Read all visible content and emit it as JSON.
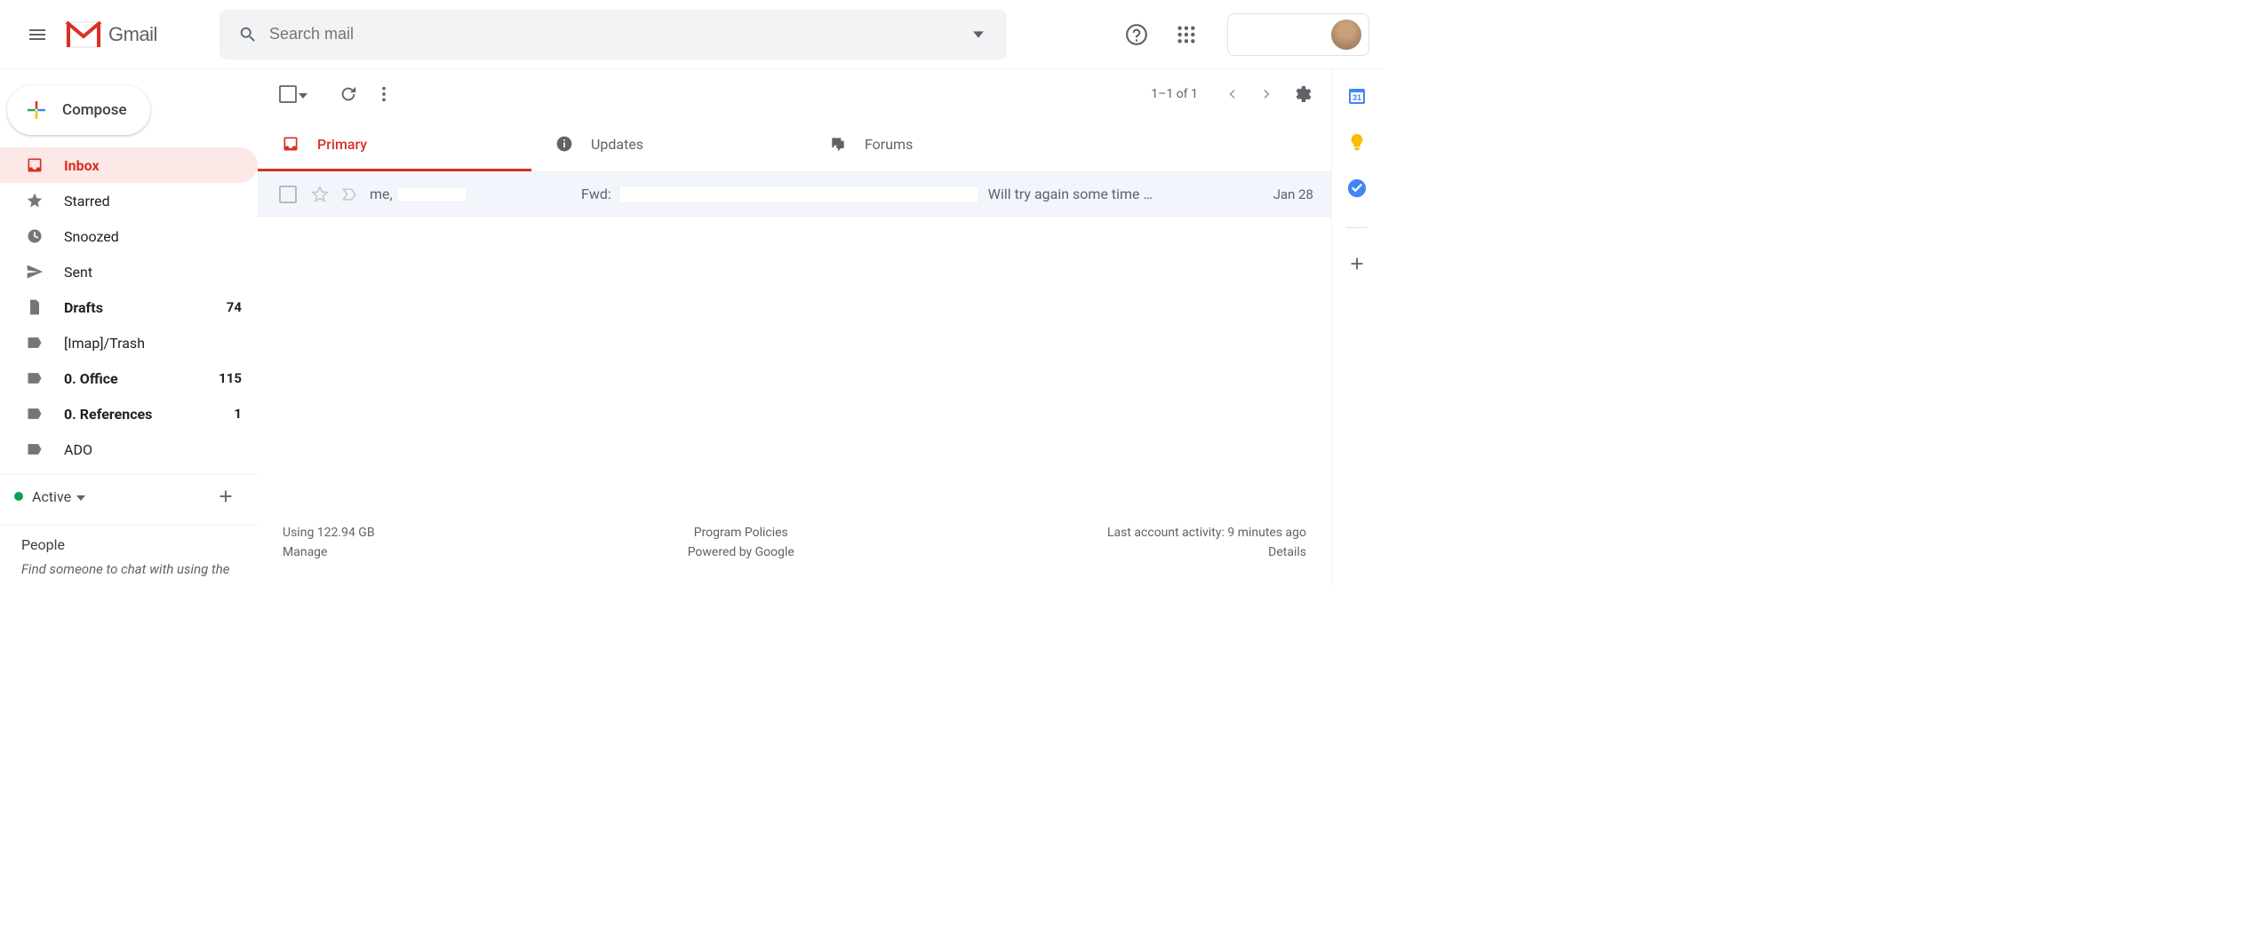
{
  "header": {
    "product_name": "Gmail",
    "search_placeholder": "Search mail"
  },
  "sidebar": {
    "compose_label": "Compose",
    "items": [
      {
        "label": "Inbox",
        "icon": "inbox",
        "count": "",
        "active": true,
        "bold": true
      },
      {
        "label": "Starred",
        "icon": "star",
        "count": "",
        "active": false,
        "bold": false
      },
      {
        "label": "Snoozed",
        "icon": "clock",
        "count": "",
        "active": false,
        "bold": false
      },
      {
        "label": "Sent",
        "icon": "send",
        "count": "",
        "active": false,
        "bold": false
      },
      {
        "label": "Drafts",
        "icon": "file",
        "count": "74",
        "active": false,
        "bold": true
      },
      {
        "label": "[Imap]/Trash",
        "icon": "label",
        "count": "",
        "active": false,
        "bold": false
      },
      {
        "label": "0. Office",
        "icon": "label",
        "count": "115",
        "active": false,
        "bold": true
      },
      {
        "label": "0. References",
        "icon": "label",
        "count": "1",
        "active": false,
        "bold": true
      },
      {
        "label": "ADO",
        "icon": "label",
        "count": "",
        "active": false,
        "bold": false
      }
    ],
    "status_label": "Active",
    "people_title": "People",
    "people_hint": "Find someone to chat with using the"
  },
  "toolbar": {
    "count_text": "1–1 of 1"
  },
  "tabs": [
    {
      "label": "Primary",
      "active": true
    },
    {
      "label": "Updates",
      "active": false
    },
    {
      "label": "Forums",
      "active": false
    }
  ],
  "messages": [
    {
      "from": "me,",
      "subject_prefix": "Fwd:",
      "snippet": "Will try again some time …",
      "date": "Jan 28"
    }
  ],
  "footer": {
    "storage_line": "Using 122.94 GB",
    "manage": "Manage",
    "policies": "Program Policies",
    "powered": "Powered by Google",
    "activity": "Last account activity: 9 minutes ago",
    "details": "Details"
  }
}
